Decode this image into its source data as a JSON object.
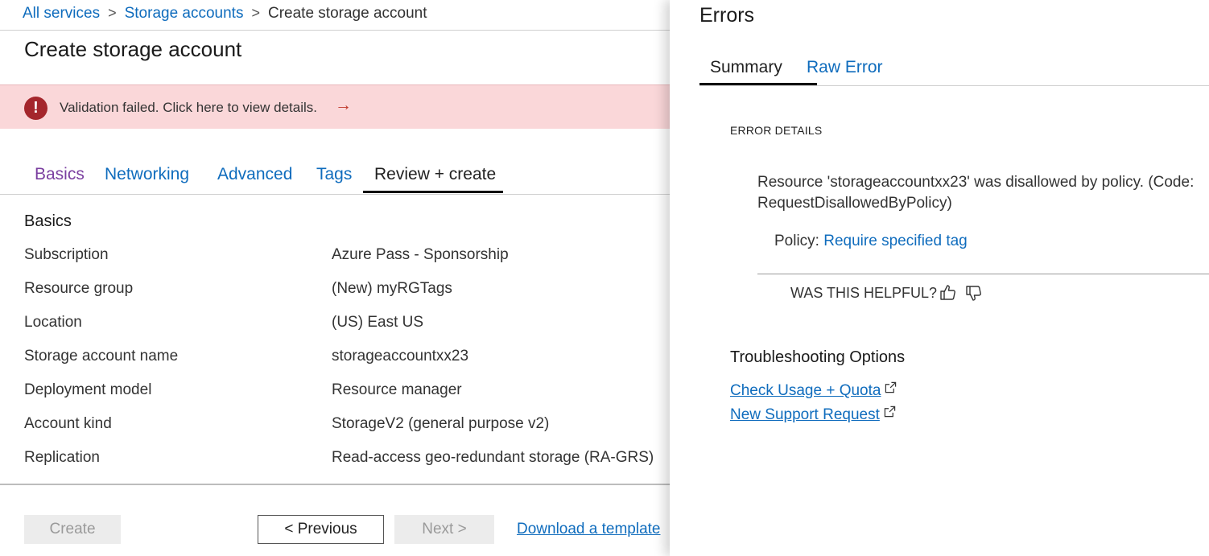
{
  "breadcrumb": {
    "items": [
      "All services",
      "Storage accounts"
    ],
    "current": "Create storage account",
    "separator": ">"
  },
  "page": {
    "title": "Create storage account"
  },
  "banner": {
    "icon": "error-icon",
    "text": "Validation failed. Click here to view details.",
    "arrow": "→",
    "color": "#fad7d9"
  },
  "tabs": [
    {
      "label": "Basics",
      "state": "visited"
    },
    {
      "label": "Networking",
      "state": "normal"
    },
    {
      "label": "Advanced",
      "state": "normal"
    },
    {
      "label": "Tags",
      "state": "normal"
    },
    {
      "label": "Review + create",
      "state": "active"
    }
  ],
  "review": {
    "section_heading": "Basics",
    "rows": [
      {
        "label": "Subscription",
        "value": "Azure Pass - Sponsorship"
      },
      {
        "label": "Resource group",
        "value": "(New) myRGTags"
      },
      {
        "label": "Location",
        "value": "(US) East US"
      },
      {
        "label": "Storage account name",
        "value": "storageaccountxx23"
      },
      {
        "label": "Deployment model",
        "value": "Resource manager"
      },
      {
        "label": "Account kind",
        "value": "StorageV2 (general purpose v2)"
      },
      {
        "label": "Replication",
        "value": "Read-access geo-redundant storage (RA-GRS)"
      }
    ]
  },
  "footer": {
    "create_label": "Create",
    "previous_label": "< Previous",
    "next_label": "Next >",
    "download_label": "Download a template"
  },
  "errors_panel": {
    "title": "Errors",
    "tabs": [
      {
        "label": "Summary",
        "state": "active"
      },
      {
        "label": "Raw Error",
        "state": "normal"
      }
    ],
    "details_heading": "ERROR DETAILS",
    "message": "Resource 'storageaccountxx23' was disallowed by policy. (Code: RequestDisallowedByPolicy)",
    "policy_prefix": "Policy:",
    "policy_link": "Require specified tag",
    "helpful_label": "WAS THIS HELPFUL?",
    "troubleshooting_heading": "Troubleshooting Options",
    "troubleshooting_links": [
      {
        "label": "Check Usage + Quota",
        "icon": "external-link-icon"
      },
      {
        "label": "New Support Request",
        "icon": "external-link-icon"
      }
    ]
  },
  "colors": {
    "link": "#0f6cbd",
    "visited": "#7b3fa0",
    "error": "#a4262c"
  }
}
